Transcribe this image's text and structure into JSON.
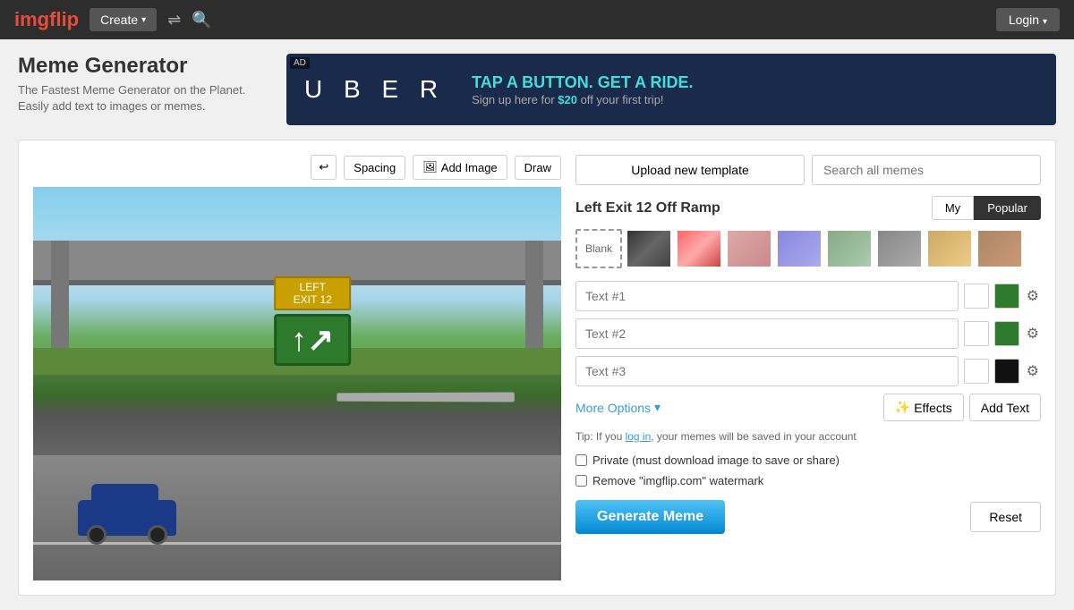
{
  "header": {
    "logo_text": "img",
    "logo_accent": "flip",
    "create_label": "Create",
    "login_label": "Login"
  },
  "page": {
    "title": "Meme Generator",
    "subtitle": "The Fastest Meme Generator on the Planet. Easily add text to images or memes."
  },
  "ad": {
    "label": "AD",
    "brand": "U  B  E  R",
    "headline": "TAP A BUTTON. GET A RIDE.",
    "subtext_pre": "Sign up here for ",
    "price": "$20",
    "subtext_post": " off your first trip!"
  },
  "toolbar": {
    "spacing_label": "Spacing",
    "add_image_label": "Add Image",
    "draw_label": "Draw"
  },
  "right": {
    "upload_label": "Upload new template",
    "search_placeholder": "Search all memes",
    "template_title": "Left Exit 12 Off Ramp",
    "tab_my": "My",
    "tab_popular": "Popular",
    "blank_label": "Blank",
    "text1_placeholder": "Text #1",
    "text2_placeholder": "Text #2",
    "text3_placeholder": "Text #3",
    "more_options_label": "More Options",
    "effects_label": "Effects",
    "add_text_label": "Add Text",
    "tip_pre": "Tip: If you ",
    "tip_link": "log in",
    "tip_post": ", your memes will be saved in your account",
    "private_label": "Private (must download image to save or share)",
    "watermark_label": "Remove \"imgflip.com\" watermark",
    "generate_label": "Generate Meme",
    "reset_label": "Reset"
  }
}
